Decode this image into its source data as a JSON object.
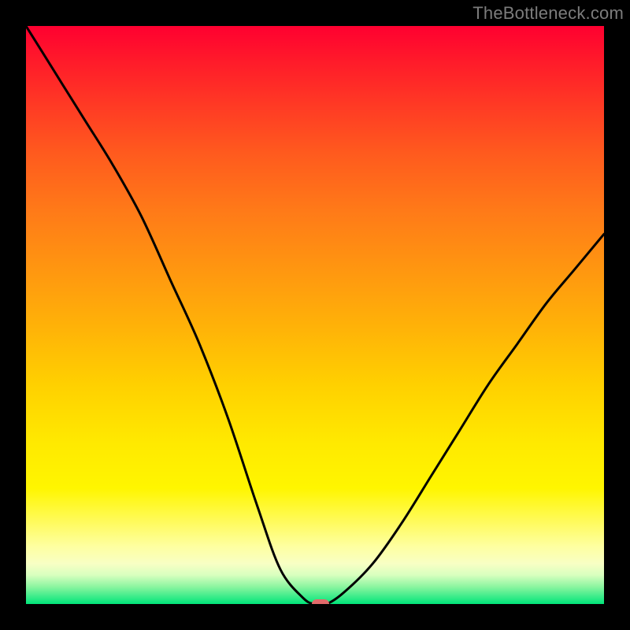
{
  "watermark": "TheBottleneck.com",
  "colors": {
    "frame": "#000000",
    "curve": "#000000",
    "marker": "#e16a6a",
    "watermark": "#7c7c7c"
  },
  "chart_data": {
    "type": "line",
    "title": "",
    "xlabel": "",
    "ylabel": "",
    "xlim": [
      0,
      100
    ],
    "ylim": [
      0,
      100
    ],
    "grid": false,
    "series": [
      {
        "name": "bottleneck-curve",
        "x": [
          0,
          5,
          10,
          15,
          20,
          25,
          30,
          35,
          40,
          44,
          48,
          50,
          52,
          55,
          60,
          65,
          70,
          75,
          80,
          85,
          90,
          95,
          100
        ],
        "values": [
          100,
          92,
          84,
          76,
          67,
          56,
          45,
          32,
          17,
          6,
          1,
          0,
          0,
          2,
          7,
          14,
          22,
          30,
          38,
          45,
          52,
          58,
          64
        ]
      }
    ],
    "marker": {
      "x": 51,
      "y": 0
    },
    "annotations": []
  }
}
